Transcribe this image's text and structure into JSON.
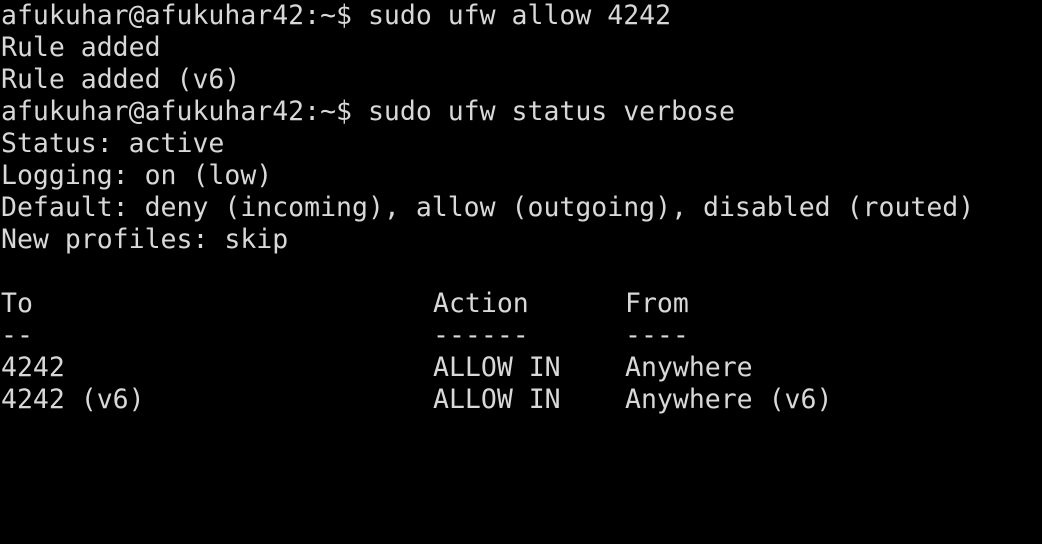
{
  "terminal": {
    "colors": {
      "background": "#000000",
      "text": "#d8d8d8"
    },
    "lines": [
      "afukuhar@afukuhar42:~$ sudo ufw allow 4242",
      "Rule added",
      "Rule added (v6)",
      "afukuhar@afukuhar42:~$ sudo ufw status verbose",
      "Status: active",
      "Logging: on (low)",
      "Default: deny (incoming), allow (outgoing), disabled (routed)",
      "New profiles: skip",
      ""
    ],
    "table": {
      "headers": {
        "to": "To",
        "action": "Action",
        "from": "From"
      },
      "separators": {
        "to": "--",
        "action": "------",
        "from": "----"
      },
      "rows": [
        {
          "to": "4242",
          "action": "ALLOW IN",
          "from": "Anywhere"
        },
        {
          "to": "4242 (v6)",
          "action": "ALLOW IN",
          "from": "Anywhere (v6)"
        }
      ]
    }
  }
}
